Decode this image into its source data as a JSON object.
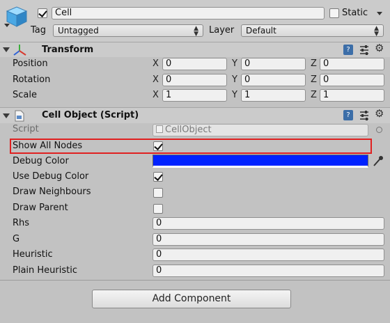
{
  "gameobject": {
    "name": "Cell",
    "active": true,
    "static_label": "Static",
    "static_checked": false,
    "tag_label": "Tag",
    "tag_value": "Untagged",
    "layer_label": "Layer",
    "layer_value": "Default"
  },
  "transform": {
    "title": "Transform",
    "rows": [
      {
        "label": "Position",
        "x": "0",
        "y": "0",
        "z": "0"
      },
      {
        "label": "Rotation",
        "x": "0",
        "y": "0",
        "z": "0"
      },
      {
        "label": "Scale",
        "x": "1",
        "y": "1",
        "z": "1"
      }
    ],
    "axis": {
      "x": "X",
      "y": "Y",
      "z": "Z"
    }
  },
  "script_component": {
    "title": "Cell Object (Script)",
    "script_label": "Script",
    "script_value": "CellObject",
    "show_all_nodes_label": "Show All Nodes",
    "show_all_nodes": true,
    "debug_color_label": "Debug Color",
    "debug_color": "#0022ff",
    "use_debug_color_label": "Use Debug Color",
    "use_debug_color": true,
    "draw_neighbours_label": "Draw Neighbours",
    "draw_neighbours": false,
    "draw_parent_label": "Draw Parent",
    "draw_parent": false,
    "rhs_label": "Rhs",
    "rhs": "0",
    "g_label": "G",
    "g": "0",
    "heuristic_label": "Heuristic",
    "heuristic": "0",
    "plain_heuristic_label": "Plain Heuristic",
    "plain_heuristic": "0"
  },
  "add_component_label": "Add Component",
  "icons": {
    "gameobject": "cube-icon",
    "transform": "transform-axes-icon",
    "script": "script-file-icon",
    "help": "help-book-icon",
    "presets": "presets-sliders-icon",
    "settings": "gear-icon",
    "eyedropper": "eyedropper-icon",
    "object_picker": "object-picker-icon"
  },
  "colors": {
    "highlight": "#e02020",
    "panel": "#c2c2c2"
  }
}
